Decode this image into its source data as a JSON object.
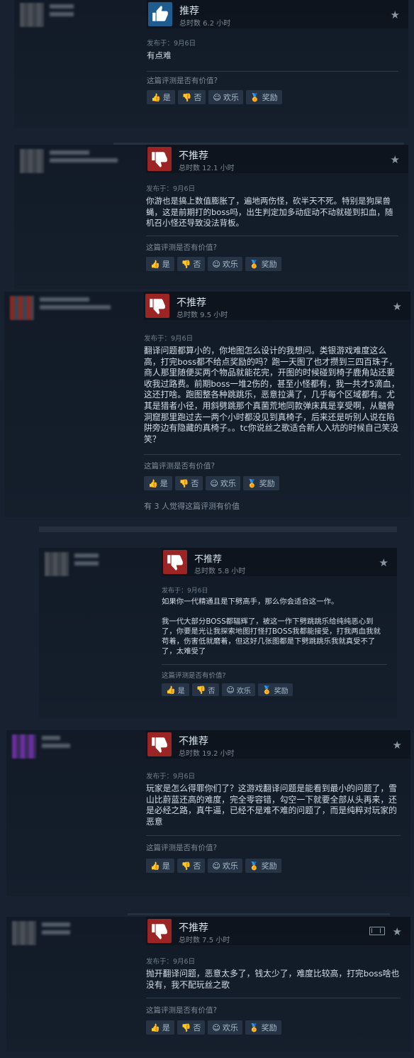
{
  "labels": {
    "recommended": "推荐",
    "not_recommended": "不推荐",
    "helpful_question": "这篇评测是否有价值?",
    "btn_yes": "是",
    "btn_no": "否",
    "btn_funny": "欢乐",
    "btn_award": "奖励"
  },
  "reviews": [
    {
      "verdict": "推荐",
      "hours": "总时数 6.2 小时",
      "posted": "发布于：9月6日",
      "content": "有点难"
    },
    {
      "verdict": "不推荐",
      "hours": "总时数 12.1 小时",
      "posted": "发布于：9月6日",
      "content": "你游也是搞上数值膨胀了，遍地两伤怪，砍半天不死。特别是狗屎兽蝇，这是前期打的boss吗，出生判定加多动症动不动就碰到扣血，随机召小怪还导致没法背板。"
    },
    {
      "verdict": "不推荐",
      "hours": "总时数 9.5 小时",
      "posted": "发布于：9月6日",
      "content": "翻译问题都算小的，你地图怎么设计的我想问。类银游戏难度这么高，打完boss都不给点奖励的吗？跑一天图了也才攒到三四百珠子，商人那里随便买两个物品就能花完，开图的时候碰到椅子鹿角站还要收我过路费。前期boss一堆2伤的，甚至小怪都有，我一共才5滴血，这还打啥。跑图整各种跳跳乐，恶意拉满了，几乎每个区域都有。尤其是猎者小径，用斜劈跳那个真菌荒地同款弹床真是享受啊，从髓骨洞窟那里跑过去一两个小时都没见到真椅子，后来还是听别人说在陷阱旁边有隐藏的真椅子。。tc你说丝之歌适合新人入坑的时候自己笑没笑？",
      "found_helpful": "有 3 人觉得这篇评测有价值"
    },
    {
      "verdict": "不推荐",
      "hours": "总时数 5.8 小时",
      "posted": "发布于：9月6日",
      "content": "如果你一代精通且是下劈高手，那么你会适合这一作。\n\n我一代大部分BOSS都辐辉了，被这一作下劈跳跳乐给纯纯恶心到了，你要是光让我探索地图打怪打BOSS我都能接受，打我两血我就苟着，伤害低就磨着，但这好几张图都是下劈跳跳乐我就真受不了了，太难受了"
    },
    {
      "verdict": "不推荐",
      "hours": "总时数 19.2 小时",
      "posted": "发布于：9月6日",
      "content": "玩家是怎么得罪你们了？这游戏翻译问题是能看到最小的问题了，雪山比蔚蓝还高的难度，完全零容错，勾空一下就要全部从头再来，还是必经之路，真牛逼，已经不是难不难的问题了，而是纯粹对玩家的恶意"
    },
    {
      "verdict": "不推荐",
      "hours": "总时数 7.5 小时",
      "posted": "发布于：9月6日",
      "content": "抛开翻译问题，恶意太多了，钱太少了，难度比较高，打完boss啥也没有，我不配玩丝之歌"
    }
  ],
  "colors": {
    "up": "#1f5c90",
    "down": "#9b2524",
    "award": "#e1b52a"
  }
}
